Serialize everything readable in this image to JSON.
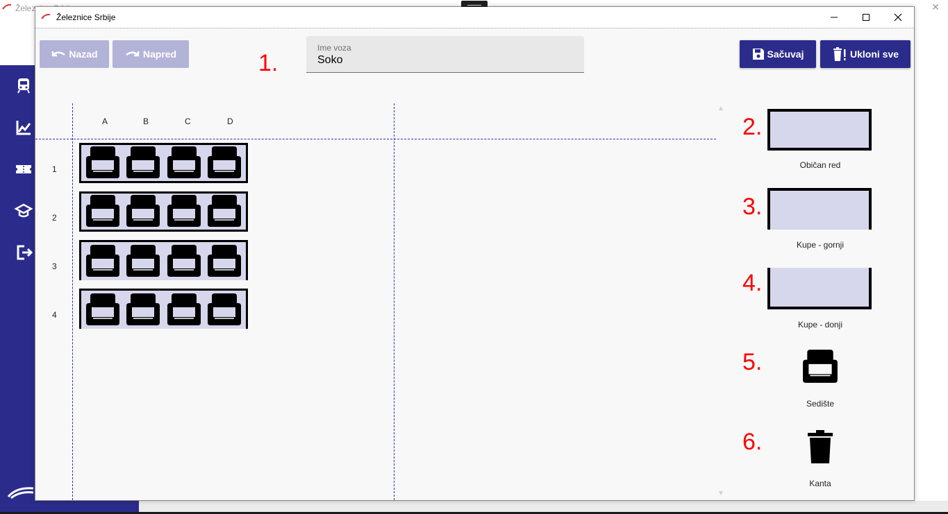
{
  "background_window": {
    "title": "Železnice Srbije",
    "nav_icons": [
      "train-icon",
      "chart-icon",
      "ticket-icon",
      "graduation-cap-icon",
      "logout-icon"
    ]
  },
  "dialog": {
    "title": "Železnice Srbije",
    "buttons": {
      "back": "Nazad",
      "forward": "Napred",
      "save": "Sačuvaj",
      "remove_all": "Ukloni sve"
    },
    "train_name": {
      "label": "Ime voza",
      "value": "Soko"
    },
    "grid": {
      "columns": [
        "A",
        "B",
        "C",
        "D"
      ],
      "rows": [
        "1",
        "2",
        "3",
        "4"
      ]
    },
    "palette": [
      {
        "num": "2.",
        "label": "Običan red"
      },
      {
        "num": "3.",
        "label": "Kupe - gornji"
      },
      {
        "num": "4.",
        "label": "Kupe - donji"
      },
      {
        "num": "5.",
        "label": "Sedište"
      },
      {
        "num": "6.",
        "label": "Kanta"
      }
    ],
    "field_number": "1."
  },
  "colors": {
    "accent": "#2b2b8c",
    "disabled": "#b3b3d8",
    "seat_bg": "#d6d6ec",
    "annotation": "#ff0000"
  }
}
